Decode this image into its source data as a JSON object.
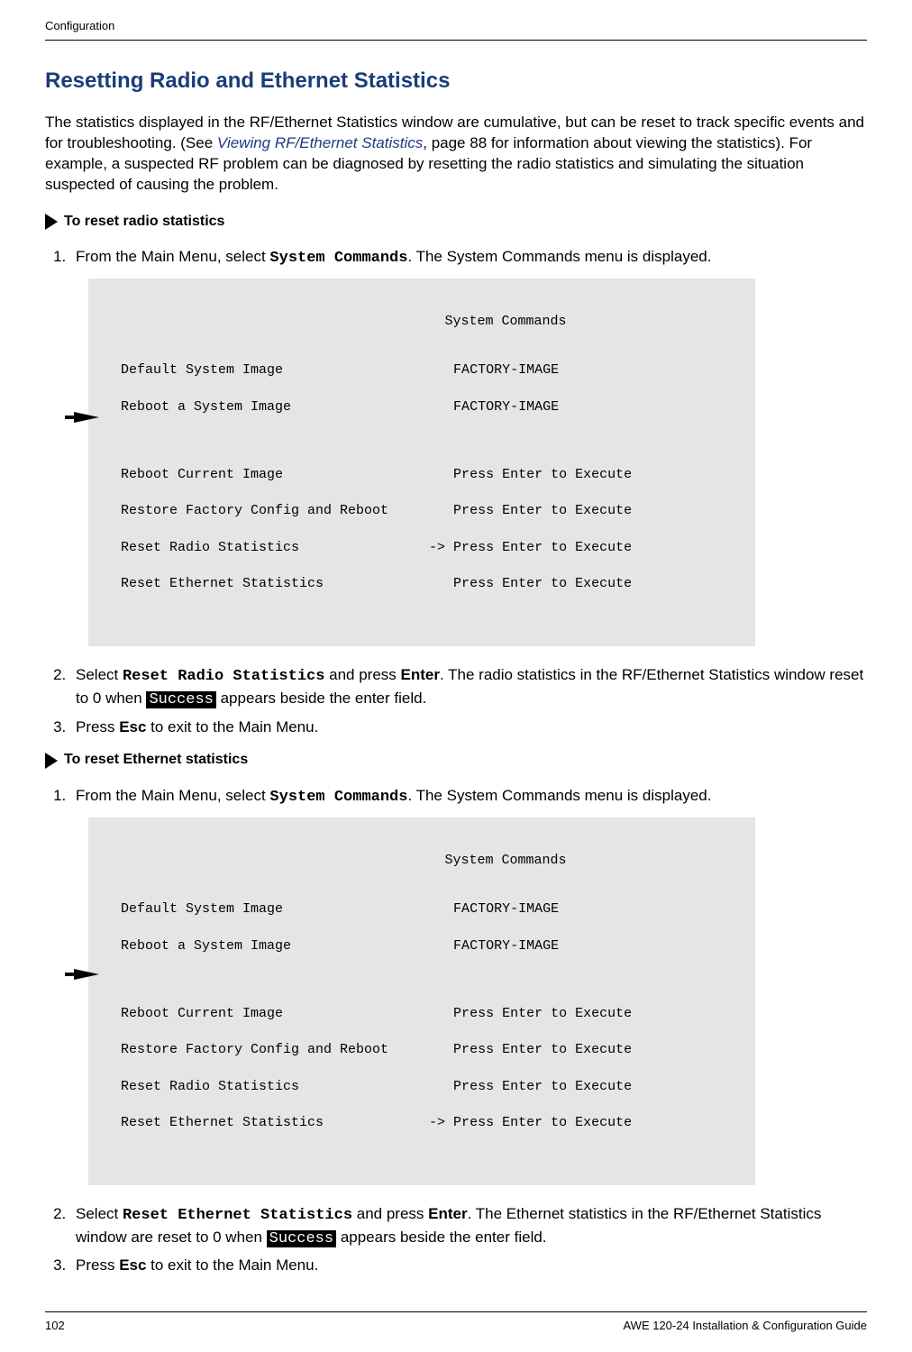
{
  "header": {
    "section": "Configuration"
  },
  "h1": "Resetting Radio and Ethernet Statistics",
  "intro": {
    "part1": "The statistics displayed in the RF/Ethernet Statistics window are cumulative, but can be reset to track specific events and for troubleshooting. (See ",
    "link": "Viewing RF/Ethernet Statistics",
    "part2": ", page 88 for information about viewing the statistics). For example, a suspected RF problem can be diagnosed by resetting the radio statistics and simulating the situation suspected of causing the problem."
  },
  "procA": {
    "title": "To reset radio statistics",
    "step1a": "From the Main Menu, select ",
    "step1_cmd": "System Commands",
    "step1b": ". The System Commands menu is displayed.",
    "code": {
      "title": "System Commands",
      "l1": "Default System Image                     FACTORY-IMAGE",
      "l2": "Reboot a System Image                    FACTORY-IMAGE",
      "l3": "Reboot Current Image                     Press Enter to Execute",
      "l4": "Restore Factory Config and Reboot        Press Enter to Execute",
      "l5": "Reset Radio Statistics                -> Press Enter to Execute",
      "l6": "Reset Ethernet Statistics                Press Enter to Execute"
    },
    "step2a": "Select ",
    "step2_cmd": "Reset Radio Statistics",
    "step2b": " and press ",
    "step2_key": "Enter",
    "step2c": ". The radio statistics in the RF/Ethernet Statistics window reset to 0 when ",
    "step2_success": "Success",
    "step2d": " appears beside the enter field.",
    "step3a": "Press ",
    "step3_key": "Esc",
    "step3b": " to exit to the Main Menu."
  },
  "procB": {
    "title": "To reset Ethernet statistics",
    "step1a": "From the Main Menu, select ",
    "step1_cmd": "System Commands",
    "step1b": ". The System Commands menu is displayed.",
    "code": {
      "title": "System Commands",
      "l1": "Default System Image                     FACTORY-IMAGE",
      "l2": "Reboot a System Image                    FACTORY-IMAGE",
      "l3": "Reboot Current Image                     Press Enter to Execute",
      "l4": "Restore Factory Config and Reboot        Press Enter to Execute",
      "l5": "Reset Radio Statistics                   Press Enter to Execute",
      "l6": "Reset Ethernet Statistics             -> Press Enter to Execute"
    },
    "step2a": "Select ",
    "step2_cmd": "Reset Ethernet Statistics",
    "step2b": " and press ",
    "step2_key": "Enter",
    "step2c": ". The Ethernet statistics in the RF/Ethernet Statistics window are reset to 0 when ",
    "step2_success": "Success",
    "step2d": " appears beside the enter field.",
    "step3a": "Press ",
    "step3_key": "Esc",
    "step3b": " to exit to the Main Menu."
  },
  "footer": {
    "page": "102",
    "doc": "AWE 120-24 Installation & Configuration Guide"
  }
}
